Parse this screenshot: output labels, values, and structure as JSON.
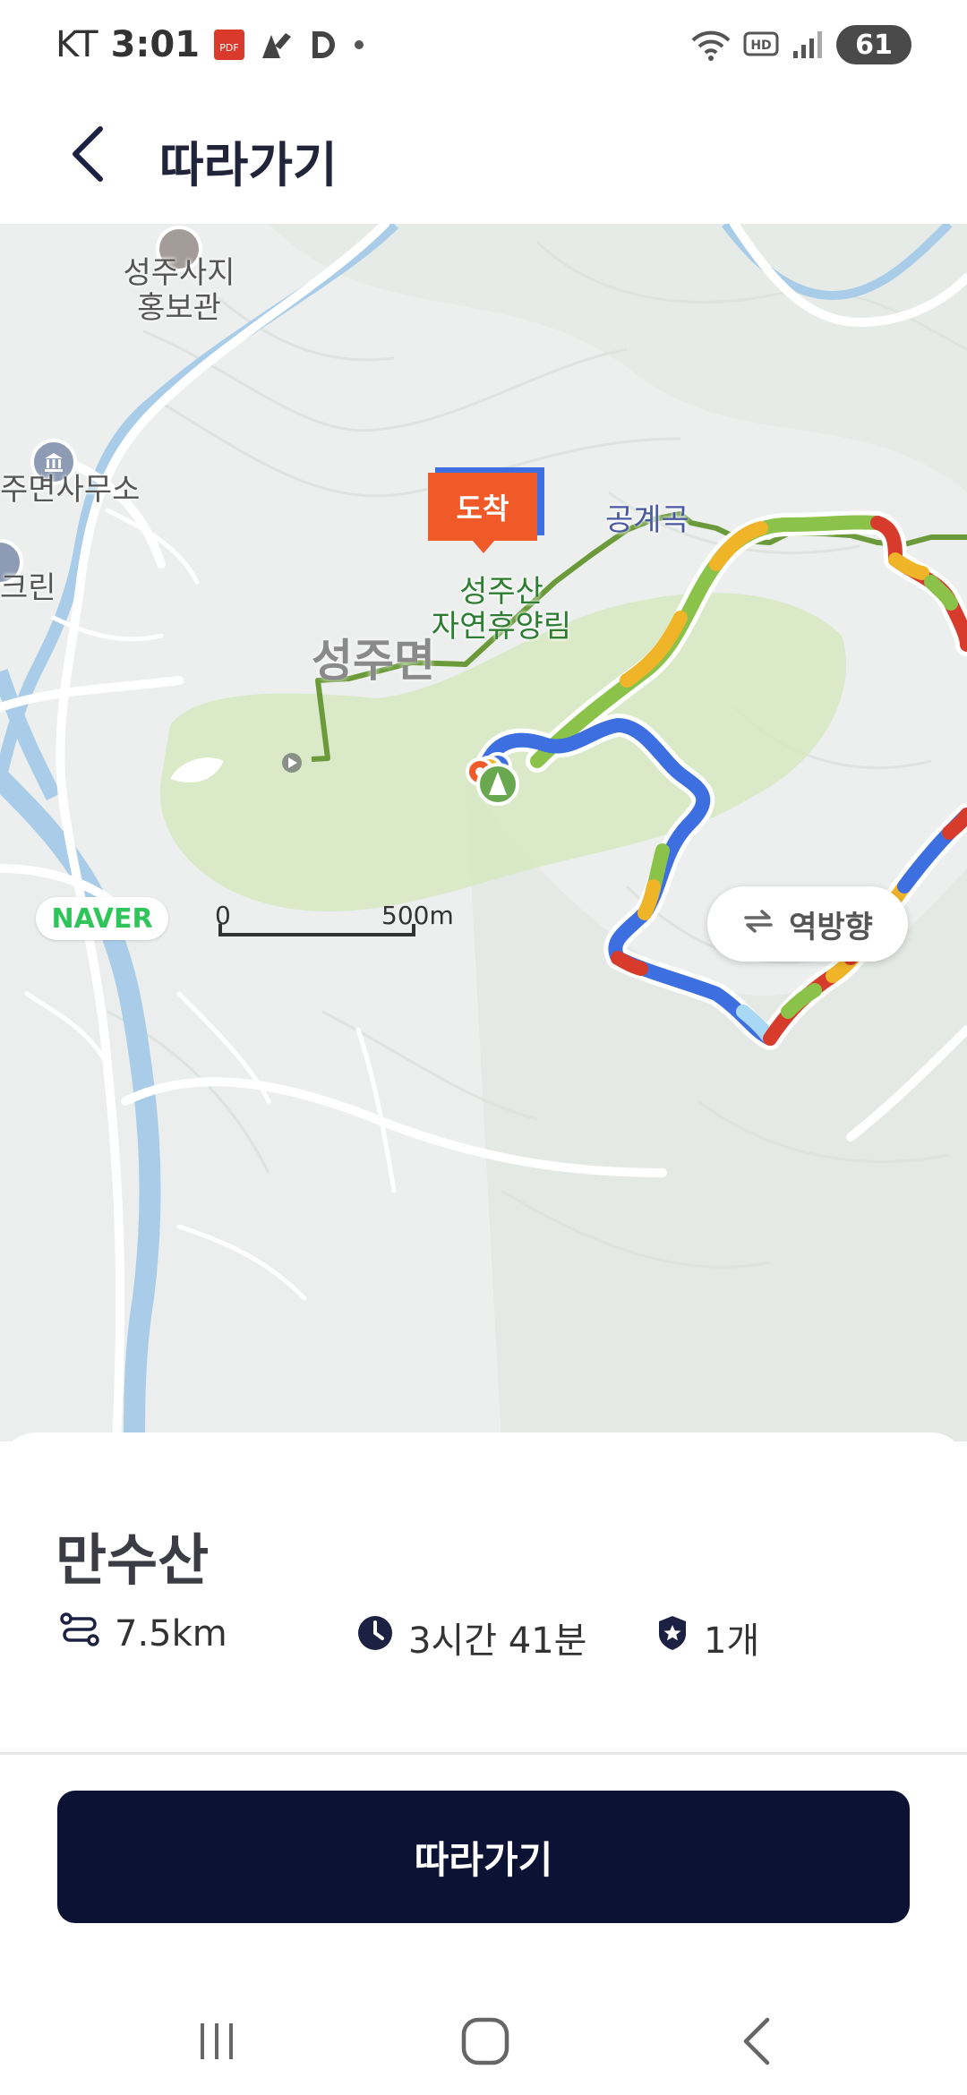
{
  "status_bar": {
    "carrier": "KT",
    "time": "3:01",
    "notification_icons": [
      "pdf-icon",
      "navigation-app-icon",
      "d-app-icon",
      "dot-icon"
    ],
    "system_icons": [
      "wifi-icon",
      "hd-voice-icon",
      "signal-icon"
    ],
    "battery": "61"
  },
  "header": {
    "title": "따라가기",
    "back_icon": "chevron-left-icon"
  },
  "map": {
    "labels": {
      "museum": "성주사지\n홍보관",
      "office": "주면사무소",
      "left_edge": "크린",
      "valley": "공계곡",
      "forest": "성주산\n자연휴양림",
      "area": "성주면"
    },
    "arrival_marker": "도착",
    "provider_logo": "NAVER",
    "scale": {
      "start": "0",
      "end": "500m"
    },
    "reverse_button": "역방향",
    "colors": {
      "route_blue": "#3d6fe0",
      "route_green": "#8bc34a",
      "route_yellow": "#f0b429",
      "route_red": "#d63b2b",
      "trail_line": "#6b9a3a",
      "forest_area": "#d7e8c2",
      "river": "#a9cde8"
    }
  },
  "trail": {
    "name": "만수산",
    "distance": "7.5km",
    "duration": "3시간 41분",
    "count": "1개"
  },
  "actions": {
    "follow_label": "따라가기"
  },
  "colors": {
    "primary": "#0c1233",
    "accent_orange": "#f05a28"
  }
}
